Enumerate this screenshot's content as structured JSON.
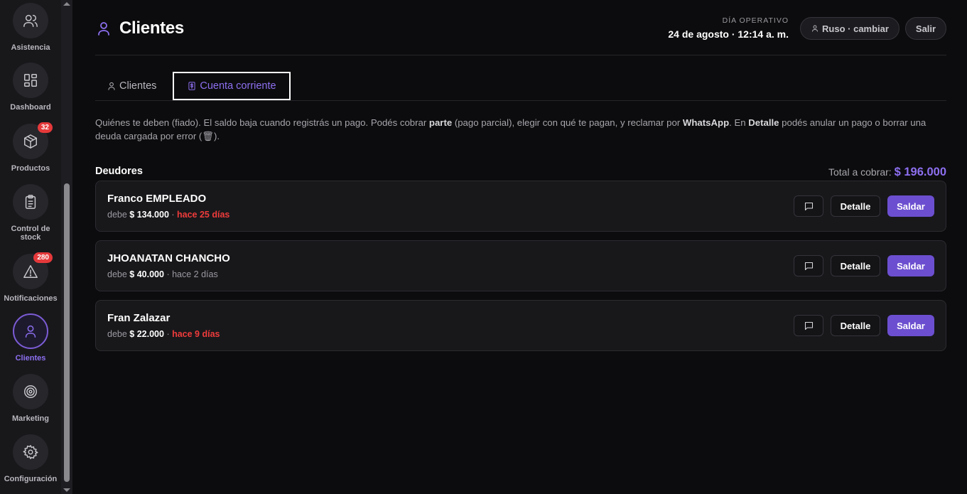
{
  "sidebar": {
    "items": [
      {
        "label": "Asistencia",
        "icon": "users-icon"
      },
      {
        "label": "Dashboard",
        "icon": "dashboard-icon"
      },
      {
        "label": "Productos",
        "icon": "box-icon",
        "badge": "32"
      },
      {
        "label": "Control de stock",
        "icon": "clipboard-icon"
      },
      {
        "label": "Notificaciones",
        "icon": "alert-icon",
        "badge": "280"
      },
      {
        "label": "Clientes",
        "icon": "user-icon",
        "active": true
      },
      {
        "label": "Marketing",
        "icon": "target-icon"
      },
      {
        "label": "Configuración",
        "icon": "gear-icon"
      }
    ]
  },
  "header": {
    "title": "Clientes",
    "day_label": "DÍA OPERATIVO",
    "day_value": "24 de agosto · 12:14 a. m.",
    "user_button": "Ruso · cambiar",
    "logout_button": "Salir"
  },
  "tabs": {
    "clientes": "Clientes",
    "cuenta_corriente": "Cuenta corriente"
  },
  "description": {
    "p1": "Quiénes te deben (fiado). El saldo baja cuando registrás un pago. Podés cobrar ",
    "b1": "parte",
    "p2": " (pago parcial), elegir con qué te pagan, y reclamar por ",
    "b2": "WhatsApp",
    "p3": ". En ",
    "b3": "Detalle",
    "p4": " podés anular un pago o borrar una deuda cargada por error (",
    "trash": "🗑",
    "p5": ")."
  },
  "debtors_section": {
    "title": "Deudores",
    "total_label": "Total a cobrar: ",
    "total_amount": "$ 196.000"
  },
  "debtors": [
    {
      "name": "Franco EMPLEADO",
      "owes_label": "debe",
      "amount": "$ 134.000",
      "sep": " · ",
      "age": "hace 25 días",
      "late": true
    },
    {
      "name": "JHOANATAN CHANCHO",
      "owes_label": "debe",
      "amount": "$ 40.000",
      "sep": " · ",
      "age": "hace 2 días",
      "late": false
    },
    {
      "name": "Fran Zalazar",
      "owes_label": "debe",
      "amount": "$ 22.000",
      "sep": " · ",
      "age": "hace 9 días",
      "late": true
    }
  ],
  "actions": {
    "detail": "Detalle",
    "settle": "Saldar"
  },
  "colors": {
    "accent": "#8d6ff0",
    "button_primary": "#6c4fd0",
    "late": "#ef3b3b",
    "badge": "#e5393b"
  }
}
